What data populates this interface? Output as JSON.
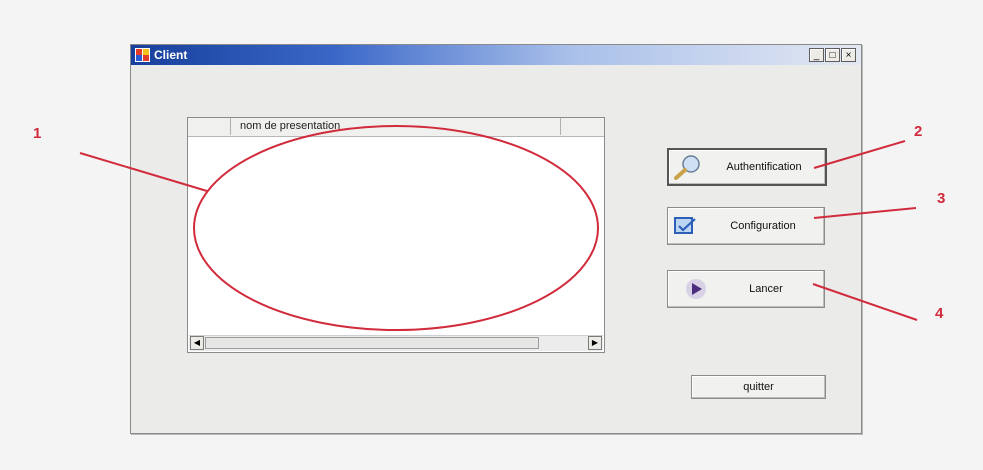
{
  "window": {
    "title": "Client",
    "controls": {
      "minimize": "_",
      "maximize": "□",
      "close": "×"
    }
  },
  "listview": {
    "columns": [
      "",
      "nom de presentation"
    ],
    "rows": []
  },
  "buttons": {
    "authentification": "Authentification",
    "configuration": "Configuration",
    "lancer": "Lancer",
    "quitter": "quitter"
  },
  "annotations": {
    "labels": [
      "1",
      "2",
      "3",
      "4"
    ],
    "color": "#d12b3c"
  },
  "icons": [
    "app-icon",
    "magnifier-icon",
    "configuration-icon",
    "play-icon"
  ]
}
